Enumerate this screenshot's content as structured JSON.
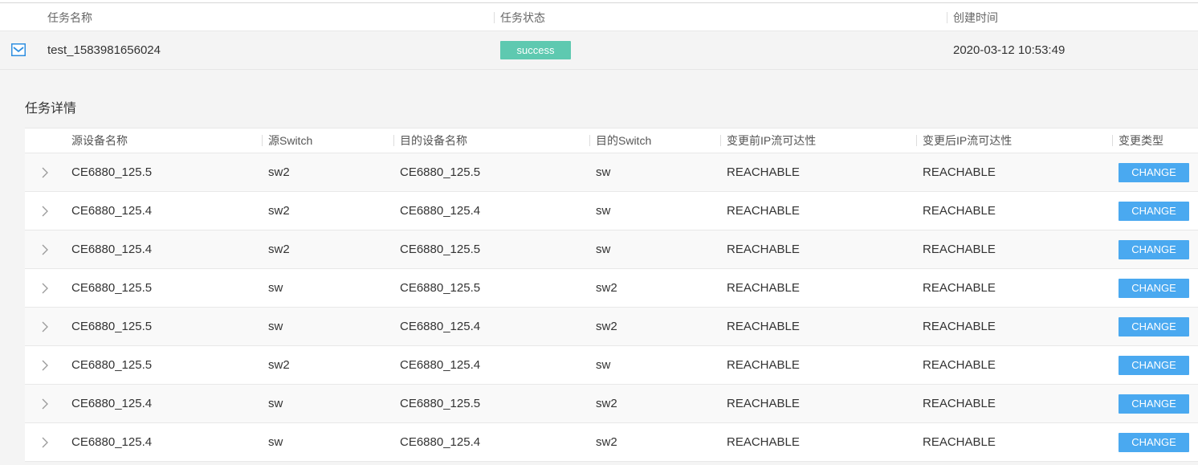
{
  "task_table": {
    "columns": {
      "name": "任务名称",
      "status": "任务状态",
      "created": "创建时间"
    },
    "row": {
      "checked": true,
      "name": "test_1583981656024",
      "status": "success",
      "created": "2020-03-12 10:53:49"
    }
  },
  "detail": {
    "title": "任务详情",
    "columns": {
      "src_device": "源设备名称",
      "src_switch": "源Switch",
      "dst_device": "目的设备名称",
      "dst_switch": "目的Switch",
      "before": "变更前IP流可达性",
      "after": "变更后IP流可达性",
      "type": "变更类型"
    },
    "rows": [
      {
        "src_device": "CE6880_125.5",
        "src_switch": "sw2",
        "dst_device": "CE6880_125.5",
        "dst_switch": "sw",
        "before": "REACHABLE",
        "after": "REACHABLE",
        "type": "CHANGE"
      },
      {
        "src_device": "CE6880_125.4",
        "src_switch": "sw2",
        "dst_device": "CE6880_125.4",
        "dst_switch": "sw",
        "before": "REACHABLE",
        "after": "REACHABLE",
        "type": "CHANGE"
      },
      {
        "src_device": "CE6880_125.4",
        "src_switch": "sw2",
        "dst_device": "CE6880_125.5",
        "dst_switch": "sw",
        "before": "REACHABLE",
        "after": "REACHABLE",
        "type": "CHANGE"
      },
      {
        "src_device": "CE6880_125.5",
        "src_switch": "sw",
        "dst_device": "CE6880_125.5",
        "dst_switch": "sw2",
        "before": "REACHABLE",
        "after": "REACHABLE",
        "type": "CHANGE"
      },
      {
        "src_device": "CE6880_125.5",
        "src_switch": "sw",
        "dst_device": "CE6880_125.4",
        "dst_switch": "sw2",
        "before": "REACHABLE",
        "after": "REACHABLE",
        "type": "CHANGE"
      },
      {
        "src_device": "CE6880_125.5",
        "src_switch": "sw2",
        "dst_device": "CE6880_125.4",
        "dst_switch": "sw",
        "before": "REACHABLE",
        "after": "REACHABLE",
        "type": "CHANGE"
      },
      {
        "src_device": "CE6880_125.4",
        "src_switch": "sw",
        "dst_device": "CE6880_125.5",
        "dst_switch": "sw2",
        "before": "REACHABLE",
        "after": "REACHABLE",
        "type": "CHANGE"
      },
      {
        "src_device": "CE6880_125.4",
        "src_switch": "sw",
        "dst_device": "CE6880_125.4",
        "dst_switch": "sw2",
        "before": "REACHABLE",
        "after": "REACHABLE",
        "type": "CHANGE"
      }
    ]
  },
  "colors": {
    "success_badge": "#5ec9b0",
    "change_button": "#4aa9f0",
    "checkbox": "#2f8fe0"
  },
  "icons": {
    "checkbox": "checkbox-checked-icon",
    "expand": "chevron-right-icon"
  }
}
